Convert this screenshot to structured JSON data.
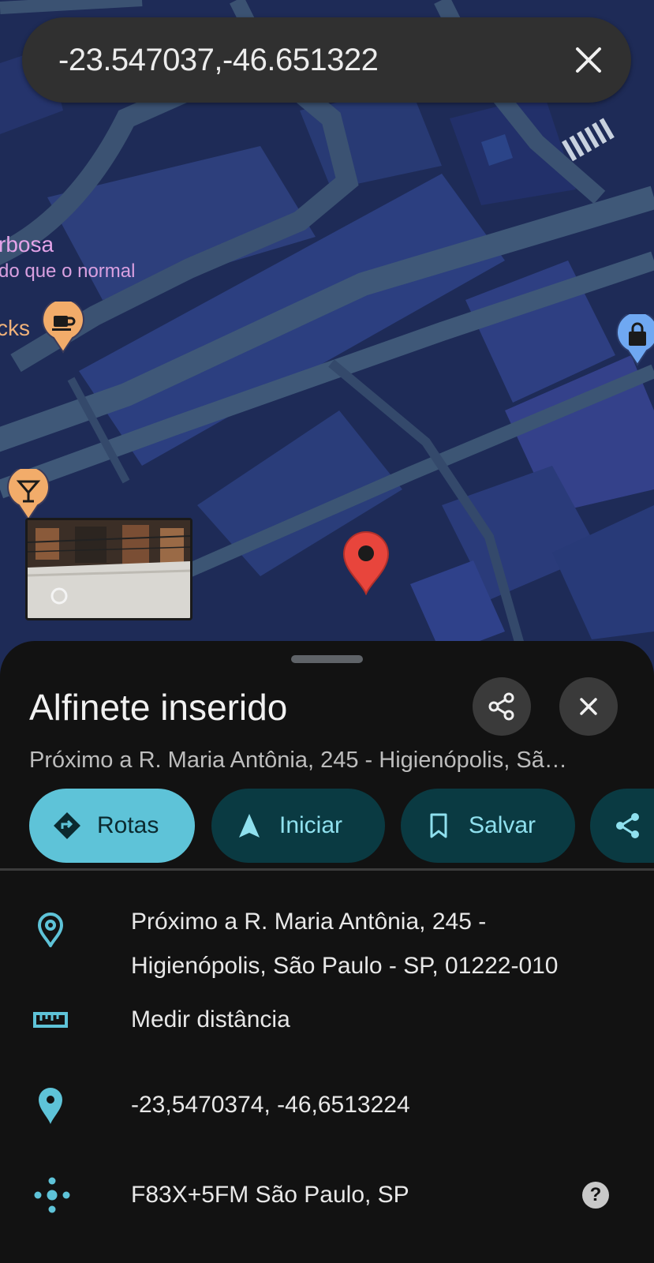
{
  "search": {
    "query": "-23.547037,-46.651322",
    "clear_icon": "close-icon"
  },
  "map": {
    "poi_labels": {
      "place_name": "rbosa",
      "place_status": "do que o normal",
      "cafe_name": "cks"
    },
    "pins": [
      "cafe-icon",
      "bar-icon",
      "shopping-bag-icon",
      "dropped-pin-icon"
    ],
    "colors": {
      "background": "#1e2b57",
      "roads": "#3f5878",
      "blocks": "#2a3f7a",
      "pin_red": "#e8453c"
    }
  },
  "sheet": {
    "title": "Alfinete inserido",
    "subtitle": "Próximo a R. Maria Antônia, 245 - Higienópolis, Sã…",
    "actions": [
      {
        "label": "Rotas",
        "icon": "directions-icon"
      },
      {
        "label": "Iniciar",
        "icon": "navigation-arrow-icon"
      },
      {
        "label": "Salvar",
        "icon": "bookmark-icon"
      },
      {
        "label": "",
        "icon": "share-icon"
      }
    ],
    "details": {
      "address_line1": "Próximo a R. Maria Antônia, 245 -",
      "address_line2": "Higienópolis, São Paulo - SP, 01222-010",
      "measure": "Medir distância",
      "coordinates": "-23,5470374, -46,6513224",
      "plus_code": "F83X+5FM São Paulo, SP",
      "help": "?"
    },
    "colors": {
      "accent": "#5ec3d8",
      "chip_dark": "#0a3a42",
      "chip_text": "#8fe0ee"
    }
  }
}
